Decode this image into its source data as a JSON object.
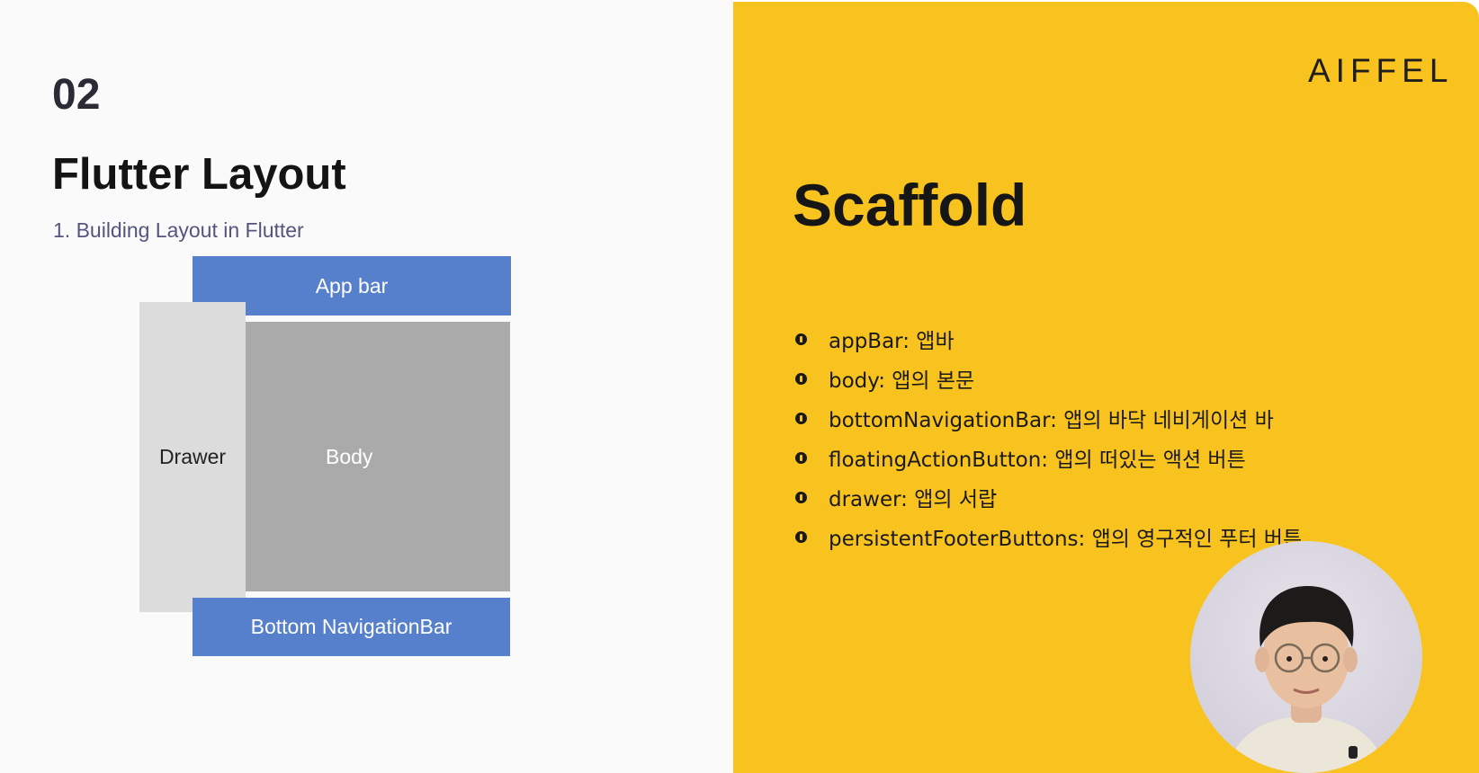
{
  "slide": {
    "section_number": "02",
    "section_title": "Flutter Layout",
    "subtitle": "1. Building Layout in Flutter"
  },
  "diagram": {
    "app_bar": "App bar",
    "drawer": "Drawer",
    "body": "Body",
    "bottom_nav": "Bottom NavigationBar"
  },
  "right_panel": {
    "logo": "AIFFEL",
    "title": "Scaffold",
    "bullets": [
      "appBar: 앱바",
      "body: 앱의 본문",
      "bottomNavigationBar: 앱의 바닥 네비게이션 바",
      "floatingActionButton: 앱의 떠있는 액션 버튼",
      "drawer: 앱의 서랍",
      "persistentFooterButtons: 앱의 영구적인 푸터 버튼"
    ]
  },
  "colors": {
    "accent_yellow": "#f9c31f",
    "diagram_blue": "#5780cc",
    "body_gray": "#aaaaaa",
    "drawer_gray": "#dcdcdc"
  },
  "icons": {
    "bullet": "circle-bullet-icon"
  }
}
